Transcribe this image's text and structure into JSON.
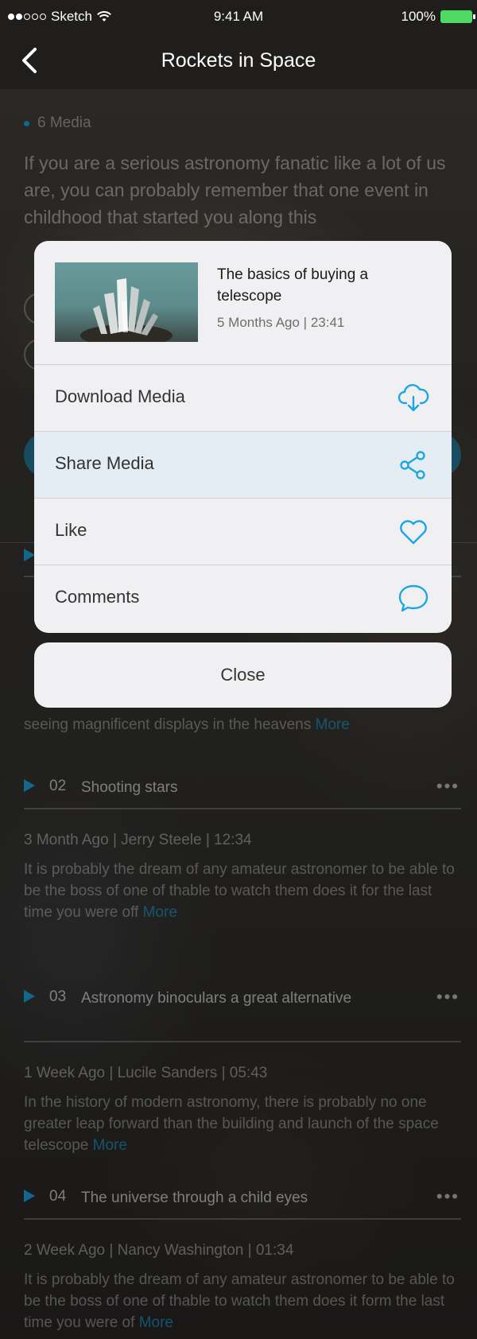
{
  "status_bar": {
    "carrier": "Sketch",
    "time": "9:41 AM",
    "battery": "100%"
  },
  "nav": {
    "title": "Rockets in Space"
  },
  "background": {
    "media_count": "6 Media",
    "intro": "If you are a serious astronomy fanatic like a lot of us are, you can probably remember that one event in childhood that started you along this",
    "items": [
      {
        "num": "",
        "title": "",
        "meta": "",
        "desc": "seeing magnificent displays in the heavens",
        "more": "More"
      },
      {
        "num": "02",
        "title": "Shooting stars",
        "meta": "3 Month Ago | Jerry Steele | 12:34",
        "desc": "It is probably the dream of any amateur astronomer to be able to be the boss of one of thable to watch them does it for the last time you were off",
        "more": "More"
      },
      {
        "num": "03",
        "title": "Astronomy binoculars a great alternative",
        "meta": "1 Week Ago | Lucile Sanders | 05:43",
        "desc": "In the history of modern astronomy, there is probably no one greater leap forward than the building and launch of the space telescope",
        "more": "More"
      },
      {
        "num": "04",
        "title": "The universe through a child eyes",
        "meta": "2 Week Ago | Nancy Washington | 01:34",
        "desc": "It is probably the dream of any amateur astronomer to be able to be the boss of one of thable to watch them does it form the last time you were of",
        "more": "More"
      }
    ]
  },
  "sheet": {
    "media_title": "The basics of buying a telescope",
    "media_meta": "5 Months Ago | 23:41",
    "options": [
      {
        "label": "Download Media",
        "icon": "cloud-download-icon"
      },
      {
        "label": "Share Media",
        "icon": "share-icon"
      },
      {
        "label": "Like",
        "icon": "heart-icon"
      },
      {
        "label": "Comments",
        "icon": "comment-bubble-icon"
      }
    ],
    "close_label": "Close"
  },
  "colors": {
    "accent": "#1da7e0",
    "sheet_bg": "#f0f0f2",
    "highlight_bg": "#e4edf3",
    "bar_bg": "#1f1e1c"
  }
}
